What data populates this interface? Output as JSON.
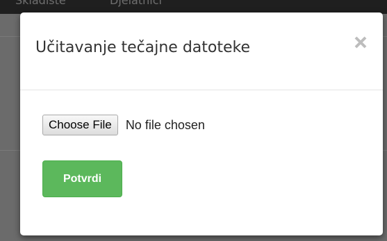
{
  "background_page": {
    "nav_items": [
      "Skladište",
      "Djelatnici"
    ]
  },
  "modal": {
    "title": "Učitavanje tečajne datoteke",
    "close_icon": "close-icon",
    "file_input": {
      "button_label": "Choose File",
      "status_text": "No file chosen"
    },
    "confirm_label": "Potvrdi"
  },
  "colors": {
    "confirm_button": "#5cb85c",
    "overlay": "#6b6b6b",
    "topbar": "#1f1f1f"
  }
}
